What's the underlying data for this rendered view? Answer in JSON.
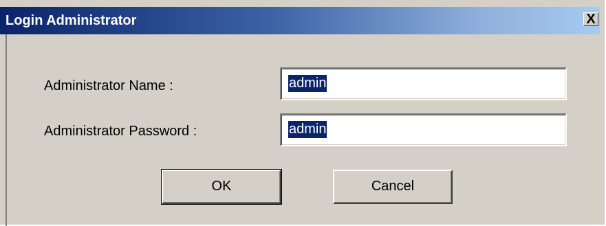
{
  "window": {
    "title": "Login Administrator",
    "close_glyph": "X"
  },
  "form": {
    "name_label": "Administrator Name :",
    "name_value": "admin",
    "password_label": "Administrator Password :",
    "password_value": "admin"
  },
  "buttons": {
    "ok_label": "OK",
    "cancel_label": "Cancel"
  },
  "colors": {
    "titlebar_start": "#0a246a",
    "titlebar_end": "#a6caf0",
    "dialog_background": "#d4d0c8",
    "selection_highlight": "#0a246a"
  }
}
